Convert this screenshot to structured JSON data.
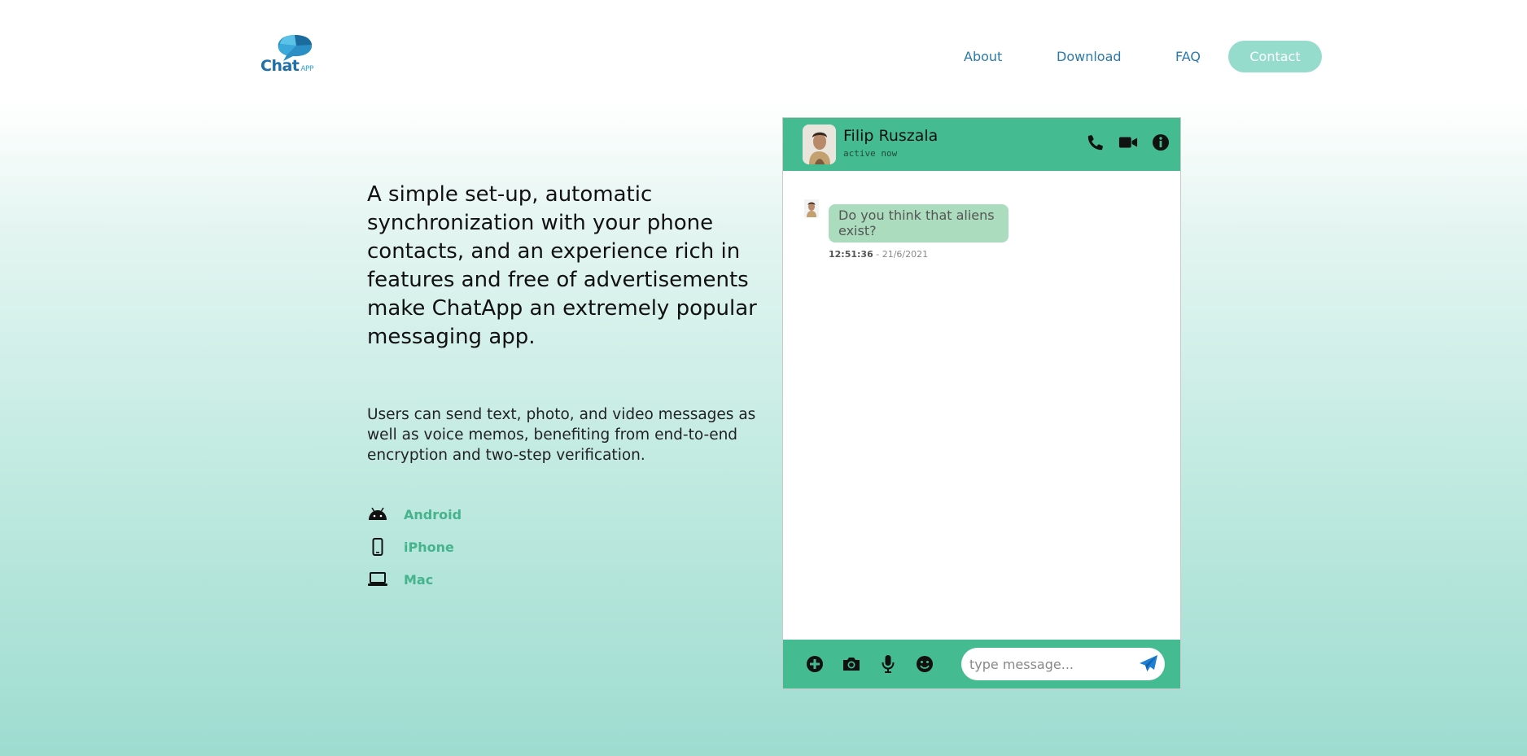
{
  "logo": {
    "text": "Chat",
    "suffix": "APP"
  },
  "nav": {
    "about": "About",
    "download": "Download",
    "faq": "FAQ",
    "contact": "Contact"
  },
  "hero": {
    "headline": "A simple set-up, automatic synchronization with your phone contacts, and an experience rich in features and free of advertisements make ChatApp an extremely popular messaging app.",
    "subtext": "Users can send text, photo, and video messages as well as voice memos, benefiting from end-to-end encryption and two-step verification."
  },
  "platforms": [
    {
      "label": "Android",
      "icon": "android-icon"
    },
    {
      "label": "iPhone",
      "icon": "mobile-icon"
    },
    {
      "label": "Mac",
      "icon": "laptop-icon"
    }
  ],
  "chat": {
    "contact_name": "Filip Ruszala",
    "contact_status": "active now",
    "header_icons": [
      "phone-icon",
      "video-icon",
      "info-icon"
    ],
    "messages": [
      {
        "text": "Do you think that aliens exist?",
        "time": "12:51:36",
        "date": "21/6/2021"
      }
    ],
    "footer_icons": [
      "plus-circle-icon",
      "camera-icon",
      "microphone-icon",
      "smile-icon"
    ],
    "input_placeholder": "type message...",
    "send_icon": "send-icon"
  },
  "colors": {
    "accent": "#45bb92",
    "bubble": "#aadcbd",
    "nav_link": "#2a79a8",
    "contact_button": "#95dccd",
    "platform_link": "#45b38c"
  }
}
